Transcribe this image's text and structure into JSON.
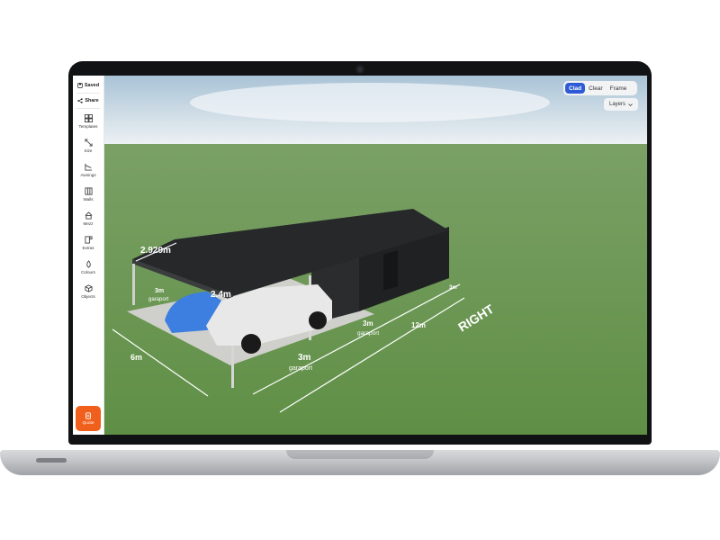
{
  "toolbar": {
    "saved_label": "Saved",
    "share_label": "Share",
    "items": [
      {
        "label": "Templates",
        "icon": "grid-icon"
      },
      {
        "label": "Size",
        "icon": "resize-icon"
      },
      {
        "label": "Awnings",
        "icon": "awning-icon"
      },
      {
        "label": "Walls",
        "icon": "wall-icon"
      },
      {
        "label": "Mezz",
        "icon": "house-icon"
      },
      {
        "label": "Extras",
        "icon": "extras-icon"
      },
      {
        "label": "Colours",
        "icon": "droplet-icon"
      },
      {
        "label": "Objects",
        "icon": "cube-icon"
      }
    ],
    "quote_label": "Quote"
  },
  "view_toggle": {
    "options": [
      "Clad",
      "Clear",
      "Frame"
    ],
    "selected": "Clad"
  },
  "layers_label": "Layers",
  "dimensions": {
    "roof_width": "2.929m",
    "height": "2.4m",
    "bay_1": "3m",
    "bay_1_name": "garaport",
    "bay_2": "3m",
    "bay_2_name": "garaport",
    "bay_3": "3m",
    "bay_3_name": "garaport",
    "bay_4": "3m",
    "total_length": "12m",
    "depth": "6m",
    "side_label": "RIGHT"
  },
  "colors": {
    "accent": "#2d5bd6",
    "quote_button": "#f0601c",
    "grass": "#6f9a56",
    "shed": "#1d1f21"
  }
}
